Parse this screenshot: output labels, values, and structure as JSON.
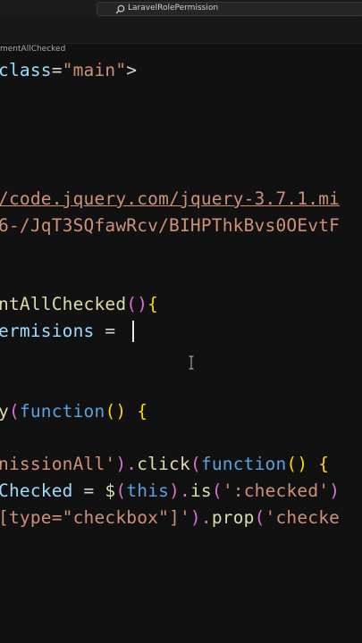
{
  "titlebar": {
    "search_text": "LaravelRolePermission"
  },
  "breadcrumb": "mentAllChecked",
  "code": {
    "l1": {
      "a": "class",
      "b": "=",
      "c": "\"main\"",
      "d": ">"
    },
    "l2": {
      "a": "/code.jquery.com/jquery-3.7.1.mi"
    },
    "l3": {
      "a": "6-/JqT3SQfawRcv/BIHPThkBvs0OEvtF"
    },
    "l4": {
      "a": "ntAllChecked",
      "b": "()",
      "c": "{"
    },
    "l5": {
      "a": "ermisions",
      "b": " = "
    },
    "l6": {
      "a": "y",
      "b": "(",
      "c": "function",
      "d": "()",
      "e": " {"
    },
    "l7": {
      "a": "nissionAll'",
      "b": ").",
      "c": "click",
      "d": "(",
      "e": "function",
      "f": "()",
      "g": " {"
    },
    "l8": {
      "a": "Checked",
      "b": " = ",
      "c": "$",
      "d": "(",
      "e": "this",
      "f": ").",
      "g": "is",
      "h": "(",
      "i": "':checked'",
      "j": ")"
    },
    "l9": {
      "a": "[type=\"checkbox\"]'",
      "b": ").",
      "c": "prop",
      "d": "(",
      "e": "'checke"
    }
  }
}
